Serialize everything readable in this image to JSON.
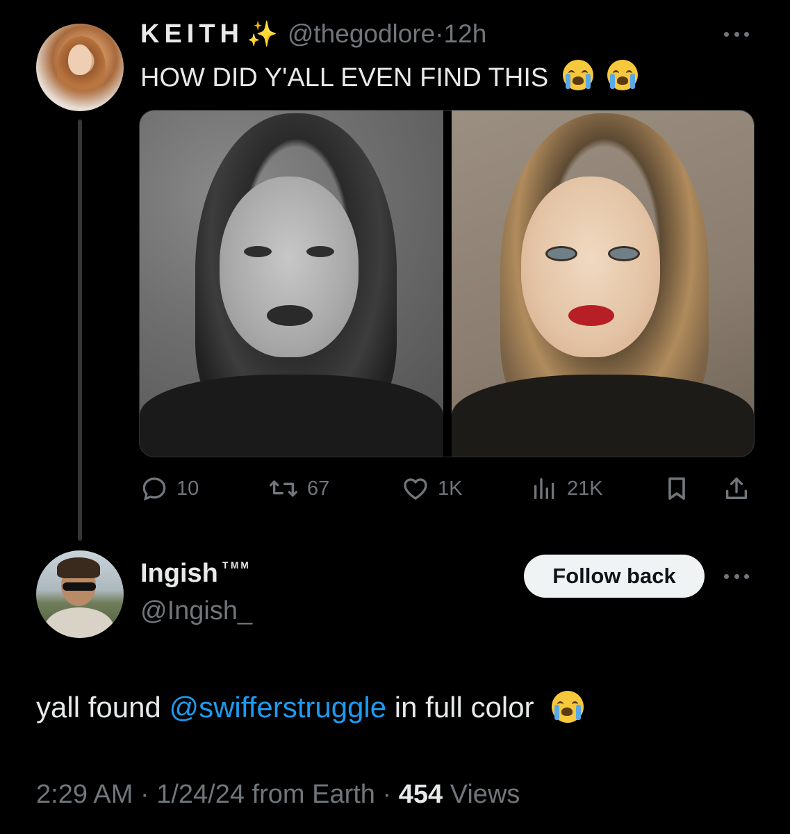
{
  "parent_tweet": {
    "display_name": "KEITH",
    "name_emoji": "✨",
    "handle": "@thegodlore",
    "separator": "·",
    "time": "12h",
    "text": "HOW DID Y'ALL EVEN FIND THIS",
    "text_emojis": [
      "loudly-crying-face",
      "loudly-crying-face"
    ],
    "actions": {
      "replies": "10",
      "retweets": "67",
      "likes": "1K",
      "views": "21K"
    },
    "media": [
      "black-and-white portrait",
      "color portrait"
    ]
  },
  "reply_tweet": {
    "display_name": "Ingish",
    "name_suffix": "ᵀᴹᴹ",
    "handle": "@Ingish_",
    "follow_button_label": "Follow back",
    "text_before": "yall found ",
    "mention": "@swifferstruggle",
    "text_after": " in full color",
    "text_emoji": "loudly-crying-face",
    "time": "2:29 AM",
    "date": "1/24/24",
    "source": "from Earth",
    "views_count": "454",
    "views_label": "Views",
    "separator": "·"
  },
  "colors": {
    "background": "#000000",
    "primary_text": "#e7e9ea",
    "secondary_text": "#71767b",
    "link": "#1d9bf0",
    "button_bg": "#eff3f4"
  }
}
